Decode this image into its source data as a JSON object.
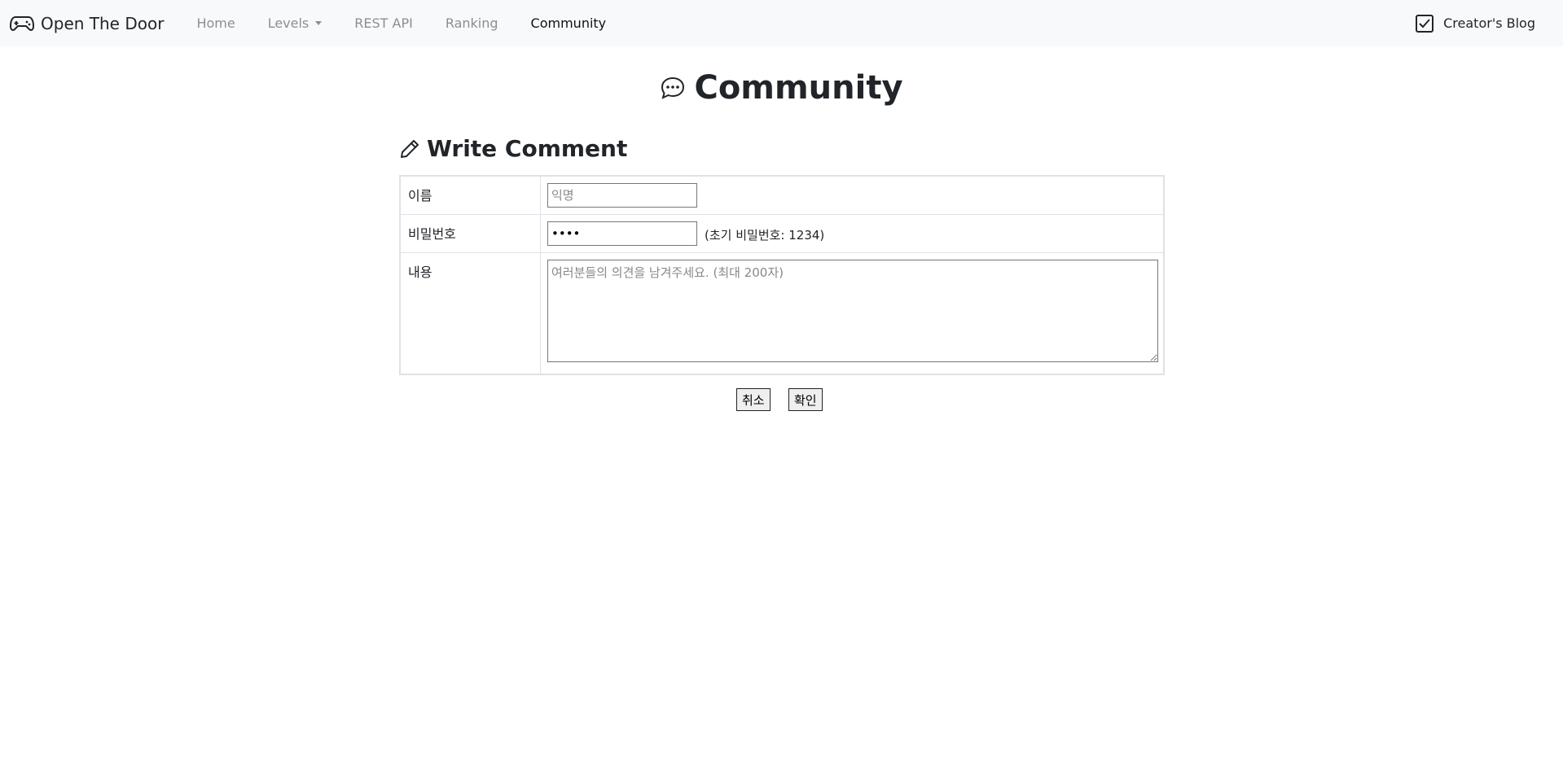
{
  "navbar": {
    "brand": "Open The Door",
    "brand_icon": "gamepad-icon",
    "links": [
      "Home",
      "Levels",
      "REST API",
      "Ranking",
      "Community"
    ],
    "active": "Community",
    "right_link": "Creator's Blog",
    "right_icon": "check-square-icon"
  },
  "page": {
    "title": "Community",
    "title_icon": "chat-dots-icon"
  },
  "form": {
    "section_title": "Write Comment",
    "section_icon": "pencil-icon",
    "name_label": "이름",
    "name_placeholder": "익명",
    "password_label": "비밀번호",
    "password_value": "1234",
    "password_hint": "(초기 비밀번호: 1234)",
    "content_label": "내용",
    "content_placeholder": "여러분들의 의견을 남겨주세요. (최대 200자)",
    "cancel_label": "취소",
    "confirm_label": "확인"
  }
}
